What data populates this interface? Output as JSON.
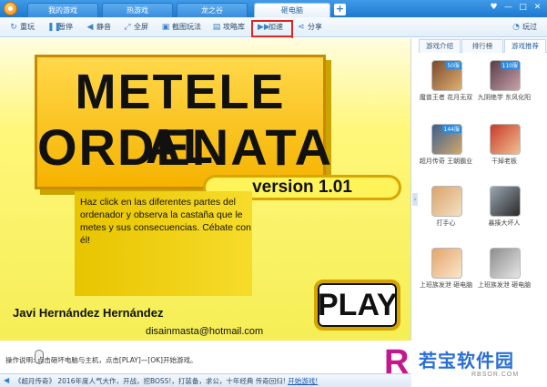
{
  "tabs": [
    {
      "label": "我的游戏"
    },
    {
      "label": "热游戏"
    },
    {
      "label": "龙之谷"
    },
    {
      "label": "砸电脑"
    }
  ],
  "window": {
    "skin": "♥",
    "minimize": "—",
    "maximize": "□",
    "close": "✕"
  },
  "toolbar": {
    "refresh": "重玩",
    "pause": "暂停",
    "mute": "静音",
    "fullscreen": "全屏",
    "screenshot": "截图玩法",
    "guide": "攻略库",
    "speed": "加速",
    "share": "分享",
    "playing": "玩过"
  },
  "colors": {
    "highlight": "#e02525",
    "accent": "#2b7fd3",
    "game_bg": "#fff77a"
  },
  "game": {
    "title_line1": "METELE AL",
    "title_line2": "ORDENATA",
    "version": "version 1.01",
    "description": "Haz click en las diferentes partes del ordenador y observa la castaña que le metes y sus consecuencias. Cébate con él!",
    "author": "Javi Hernández Hernández",
    "email": "disainmasta@hotmail.com",
    "play": "PLAY"
  },
  "right_panel": {
    "tabs": [
      "游戏介绍",
      "排行榜",
      "游戏推荐"
    ],
    "games": [
      {
        "name": "魔兽王者 花月无双",
        "badge": "50服",
        "icon": "game-warrior-icon",
        "color": "#7a4b2e"
      },
      {
        "name": "九阴绝学 东风化阳",
        "badge": "110服",
        "icon": "game-heroine-icon",
        "color": "#5a3d4a"
      },
      {
        "name": "超月传奇 王朝霸业",
        "badge": "144服",
        "icon": "game-mage-icon",
        "color": "#3a5f8f"
      },
      {
        "name": "干掉老板",
        "badge": "",
        "icon": "game-boss-icon",
        "color": "#c83a2a"
      },
      {
        "name": "打手心",
        "badge": "",
        "icon": "game-hands-icon",
        "color": "#d9a36a"
      },
      {
        "name": "暴揍大坏人",
        "badge": "",
        "icon": "game-stickman-icon",
        "color": "#9aa7b2"
      },
      {
        "name": "上班族发泄 砸电脑",
        "badge": "",
        "icon": "game-office-icon",
        "color": "#e3a56a"
      },
      {
        "name": "上班族发泄 砸电脑",
        "badge": "",
        "icon": "game-office2-icon",
        "color": "#8d8d8d"
      }
    ]
  },
  "bottom": {
    "hint": "操作说明:   点击砸坏电脑与主机，点击[PLAY]—[OK]开始游戏。",
    "ticker_game": "《超月传奇》",
    "ticker": "2016年度人气大作，开战，挖BOSS!，打装备，求公，十年经典 传奇回归!",
    "ticker_link": "开始游戏!"
  },
  "watermark": {
    "mark": "R",
    "title": "若宝软件园",
    "sub": "RBSOR.COM"
  }
}
